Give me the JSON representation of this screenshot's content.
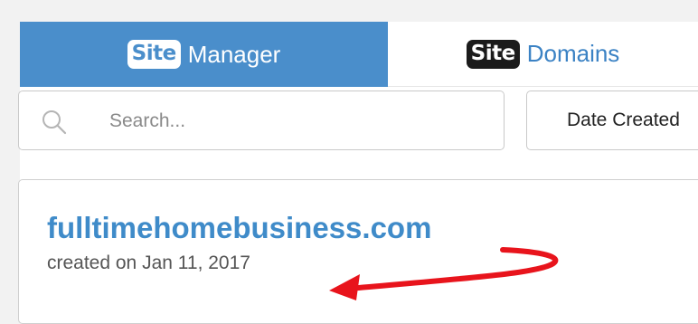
{
  "tabs": {
    "manager": {
      "badge": "Site",
      "label": "Manager"
    },
    "domains": {
      "badge": "Site",
      "label": "Domains"
    }
  },
  "search": {
    "placeholder": "Search...",
    "value": ""
  },
  "sort": {
    "selected": "Date Created"
  },
  "site": {
    "domain": "fulltimehomebusiness.com",
    "created": "created on Jan 11, 2017"
  },
  "colors": {
    "active_tab": "#4a8ecb",
    "link": "#3f8bc9",
    "annotation_arrow": "#e8141c"
  },
  "icons": {
    "search": "search-icon",
    "annotation": "red-arrow-annotation"
  }
}
